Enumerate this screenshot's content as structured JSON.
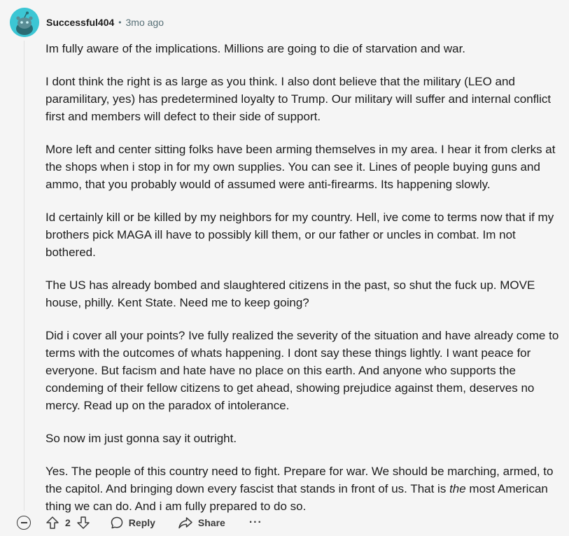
{
  "comment": {
    "author": "Successful404",
    "separator": "•",
    "time": "3mo ago",
    "paragraphs": [
      "Im fully aware of the implications. Millions are going to die of starvation and war.",
      "I dont think the right is as large as you think. I also dont believe that the military (LEO and paramilitary, yes) has predetermined loyalty to Trump. Our military will suffer and internal conflict first and members will defect to their side of support.",
      "More left and center sitting folks have been arming themselves in my area. I hear it from clerks at the shops when i stop in for my own supplies. You can see it. Lines of people buying guns and ammo, that you probably would of assumed were anti-firearms. Its happening slowly.",
      "Id certainly kill or be killed by my neighbors for my country. Hell, ive come to terms now that if my brothers pick MAGA ill have to possibly kill them, or our father or uncles in combat. Im not bothered.",
      "The US has already bombed and slaughtered citizens in the past, so shut the fuck up. MOVE house, philly. Kent State. Need me to keep going?",
      "Did i cover all your points? Ive fully realized the severity of the situation and have already come to terms with the outcomes of whats happening. I dont say these things lightly. I want peace for everyone. But facism and hate have no place on this earth. And anyone who supports the condeming of their fellow citizens to get ahead, showing prejudice against them, deserves no mercy. Read up on the paradox of intolerance.",
      "So now im just gonna say it outright."
    ],
    "final_paragraph": {
      "before": "Yes. The people of this country need to fight. Prepare for war. We should be marching, armed, to the capitol. And bringing down every fascist that stands in front of us. That is ",
      "emphasis": "the",
      "after": " most American thing we can do. And i am fully prepared to do so."
    }
  },
  "actions": {
    "vote_count": "2",
    "reply_label": "Reply",
    "share_label": "Share",
    "more_label": "···"
  },
  "colors": {
    "background": "#f5f5f5",
    "avatar": "#3cc6d4",
    "meta_text": "#576f76"
  },
  "icons": [
    "avatar-snoo-icon",
    "collapse-icon",
    "upvote-icon",
    "downvote-icon",
    "reply-icon",
    "share-icon",
    "more-icon"
  ]
}
